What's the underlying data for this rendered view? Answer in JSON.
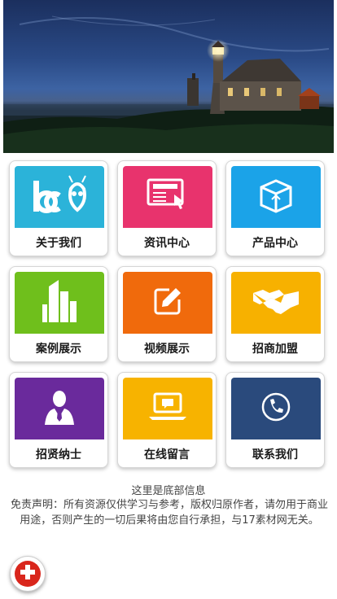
{
  "banner": {
    "image": "lighthouse-church-night-photo"
  },
  "tiles": [
    {
      "label": "关于我们",
      "color": "#2bb3d9",
      "icon": "about-logo-icon"
    },
    {
      "label": "资讯中心",
      "color": "#e8336d",
      "icon": "news-icon"
    },
    {
      "label": "产品中心",
      "color": "#1ba3e8",
      "icon": "product-box-icon"
    },
    {
      "label": "案例展示",
      "color": "#6fbf1c",
      "icon": "buildings-icon"
    },
    {
      "label": "视频展示",
      "color": "#f06a0c",
      "icon": "edit-icon"
    },
    {
      "label": "招商加盟",
      "color": "#f7b100",
      "icon": "handshake-icon"
    },
    {
      "label": "招贤纳士",
      "color": "#6a2a9c",
      "icon": "person-suit-icon"
    },
    {
      "label": "在线留言",
      "color": "#f7b300",
      "icon": "laptop-message-icon"
    },
    {
      "label": "联系我们",
      "color": "#2a4a7c",
      "icon": "phone-icon"
    }
  ],
  "footer": {
    "title": "这里是底部信息",
    "disclaimer": "免责声明：所有资源仅供学习与参考，版权归原作者，请勿用于商业用途，否则产生的一切后果将由您自行承担，与17素材网无关。"
  },
  "fab": {
    "icon": "plus-icon",
    "color": "#d9261c"
  }
}
